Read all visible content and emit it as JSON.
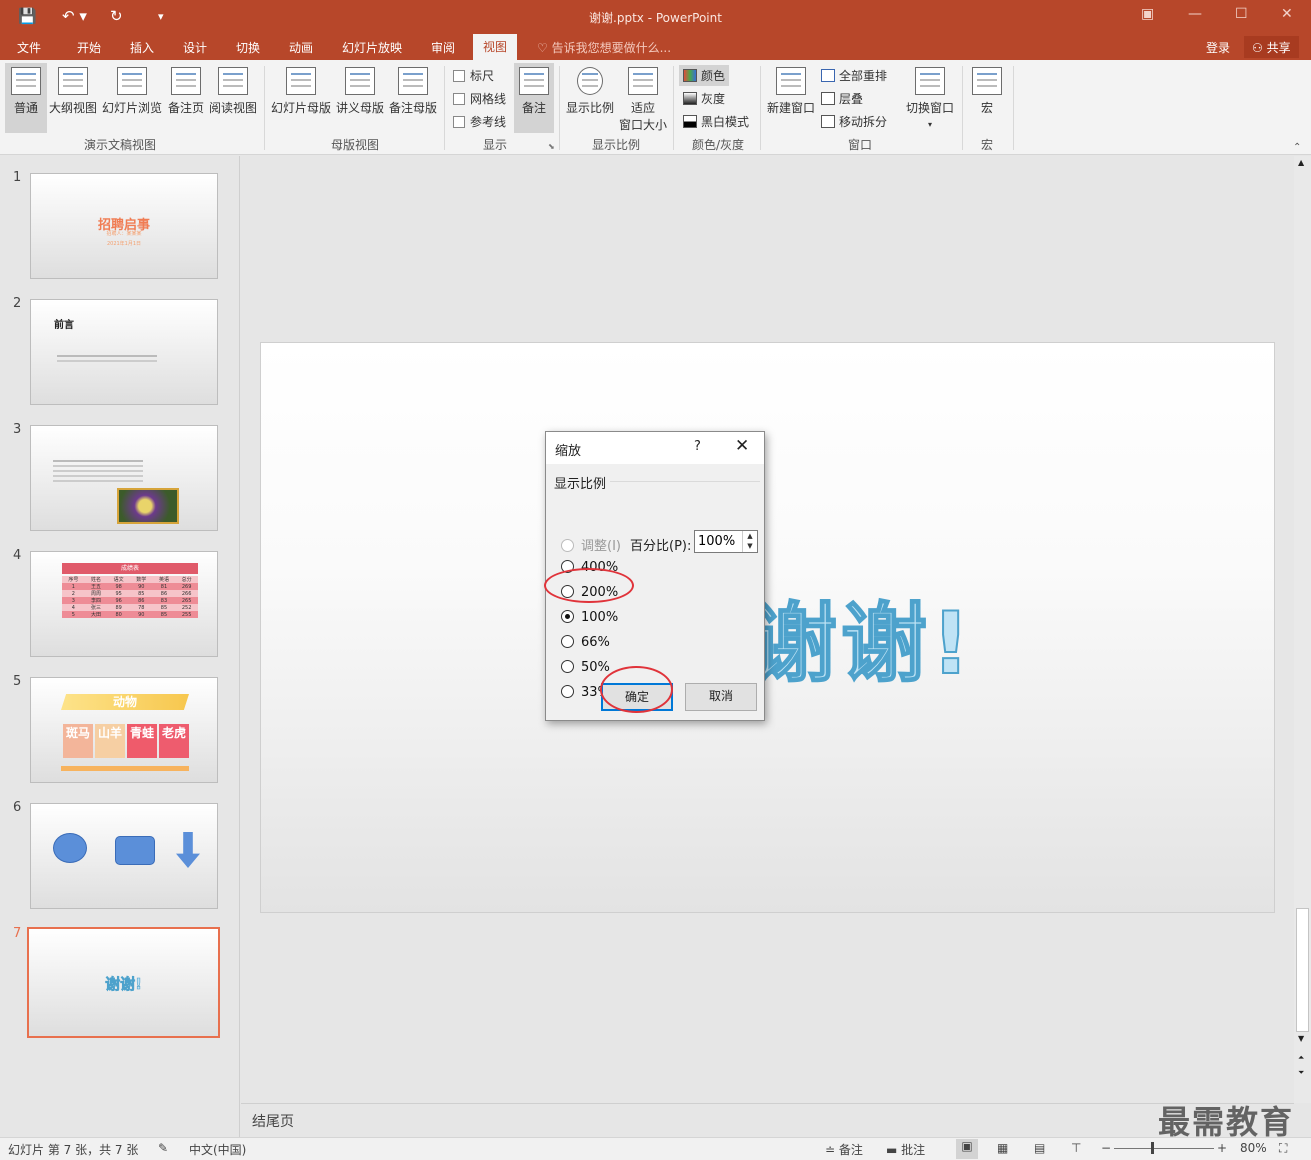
{
  "window": {
    "title": "谢谢.pptx - PowerPoint",
    "minimize": "—",
    "restore": "☐",
    "close": "✕",
    "options": "▣"
  },
  "quick_access": {
    "save": "💾",
    "undo": "↶ ▾",
    "redo": "↻",
    "customize": "▾"
  },
  "tabs": [
    "文件",
    "开始",
    "插入",
    "设计",
    "切换",
    "动画",
    "幻灯片放映",
    "审阅",
    "视图"
  ],
  "active_tab": "视图",
  "tell_me": "告诉我您想要做什么...",
  "account": {
    "login": "登录",
    "share": "共享"
  },
  "ribbon": {
    "presentation_views": {
      "label": "演示文稿视图",
      "items": [
        "普通",
        "大纲视图",
        "幻灯片浏览",
        "备注页",
        "阅读视图"
      ]
    },
    "master_views": {
      "label": "母版视图",
      "items": [
        "幻灯片母版",
        "讲义母版",
        "备注母版"
      ]
    },
    "show": {
      "label": "显示",
      "checks": [
        "标尺",
        "网格线",
        "参考线"
      ],
      "notes": "备注"
    },
    "zoom": {
      "label": "显示比例",
      "zoom": "显示比例",
      "fit": [
        "适应",
        "窗口大小"
      ]
    },
    "color": {
      "label": "颜色/灰度",
      "items": [
        "颜色",
        "灰度",
        "黑白模式"
      ]
    },
    "window": {
      "label": "窗口",
      "new": "新建窗口",
      "items": [
        "全部重排",
        "层叠",
        "移动拆分"
      ],
      "switch": "切换窗口"
    },
    "macros": {
      "label": "宏",
      "item": "宏"
    }
  },
  "slides": [
    {
      "num": "1",
      "title": "招聘启事",
      "lines": [
        "招聘人：某某某",
        "2021年1月1日"
      ]
    },
    {
      "num": "2",
      "title": "前言"
    },
    {
      "num": "3",
      "title": ""
    },
    {
      "num": "4",
      "title": "成绩表",
      "headers": [
        "序号",
        "姓名",
        "语文",
        "数学",
        "英语",
        "总分"
      ],
      "rows": [
        [
          "1",
          "王五",
          "98",
          "90",
          "81",
          "269"
        ],
        [
          "2",
          "周周",
          "95",
          "85",
          "86",
          "266"
        ],
        [
          "3",
          "李四",
          "96",
          "86",
          "83",
          "265"
        ],
        [
          "4",
          "张三",
          "89",
          "78",
          "85",
          "252"
        ],
        [
          "5",
          "大田",
          "80",
          "90",
          "85",
          "255"
        ]
      ]
    },
    {
      "num": "5",
      "title": "动物",
      "animals": [
        "斑马",
        "山羊",
        "青蛙",
        "老虎"
      ]
    },
    {
      "num": "6",
      "title": ""
    },
    {
      "num": "7",
      "title": "谢谢!"
    }
  ],
  "slide_main_text": "谢谢!",
  "notes_text": "结尾页",
  "dialog": {
    "title": "缩放",
    "help": "?",
    "close": "✕",
    "group_label": "显示比例",
    "options": [
      "调整(I)",
      "400%",
      "200%",
      "100%",
      "66%",
      "50%",
      "33%"
    ],
    "selected": "100%",
    "percent_label": "百分比(P):",
    "percent_value": "100%",
    "ok": "确定",
    "cancel": "取消"
  },
  "status": {
    "slide_info": "幻灯片 第 7 张，共 7 张",
    "language": "中文(中国)",
    "notes": "备注",
    "comments": "批注",
    "zoom_level": "80%"
  },
  "watermark": "最需教育",
  "colors": {
    "accent": "#b7472a",
    "selection": "#e8704e",
    "annotation": "#e0333a"
  }
}
